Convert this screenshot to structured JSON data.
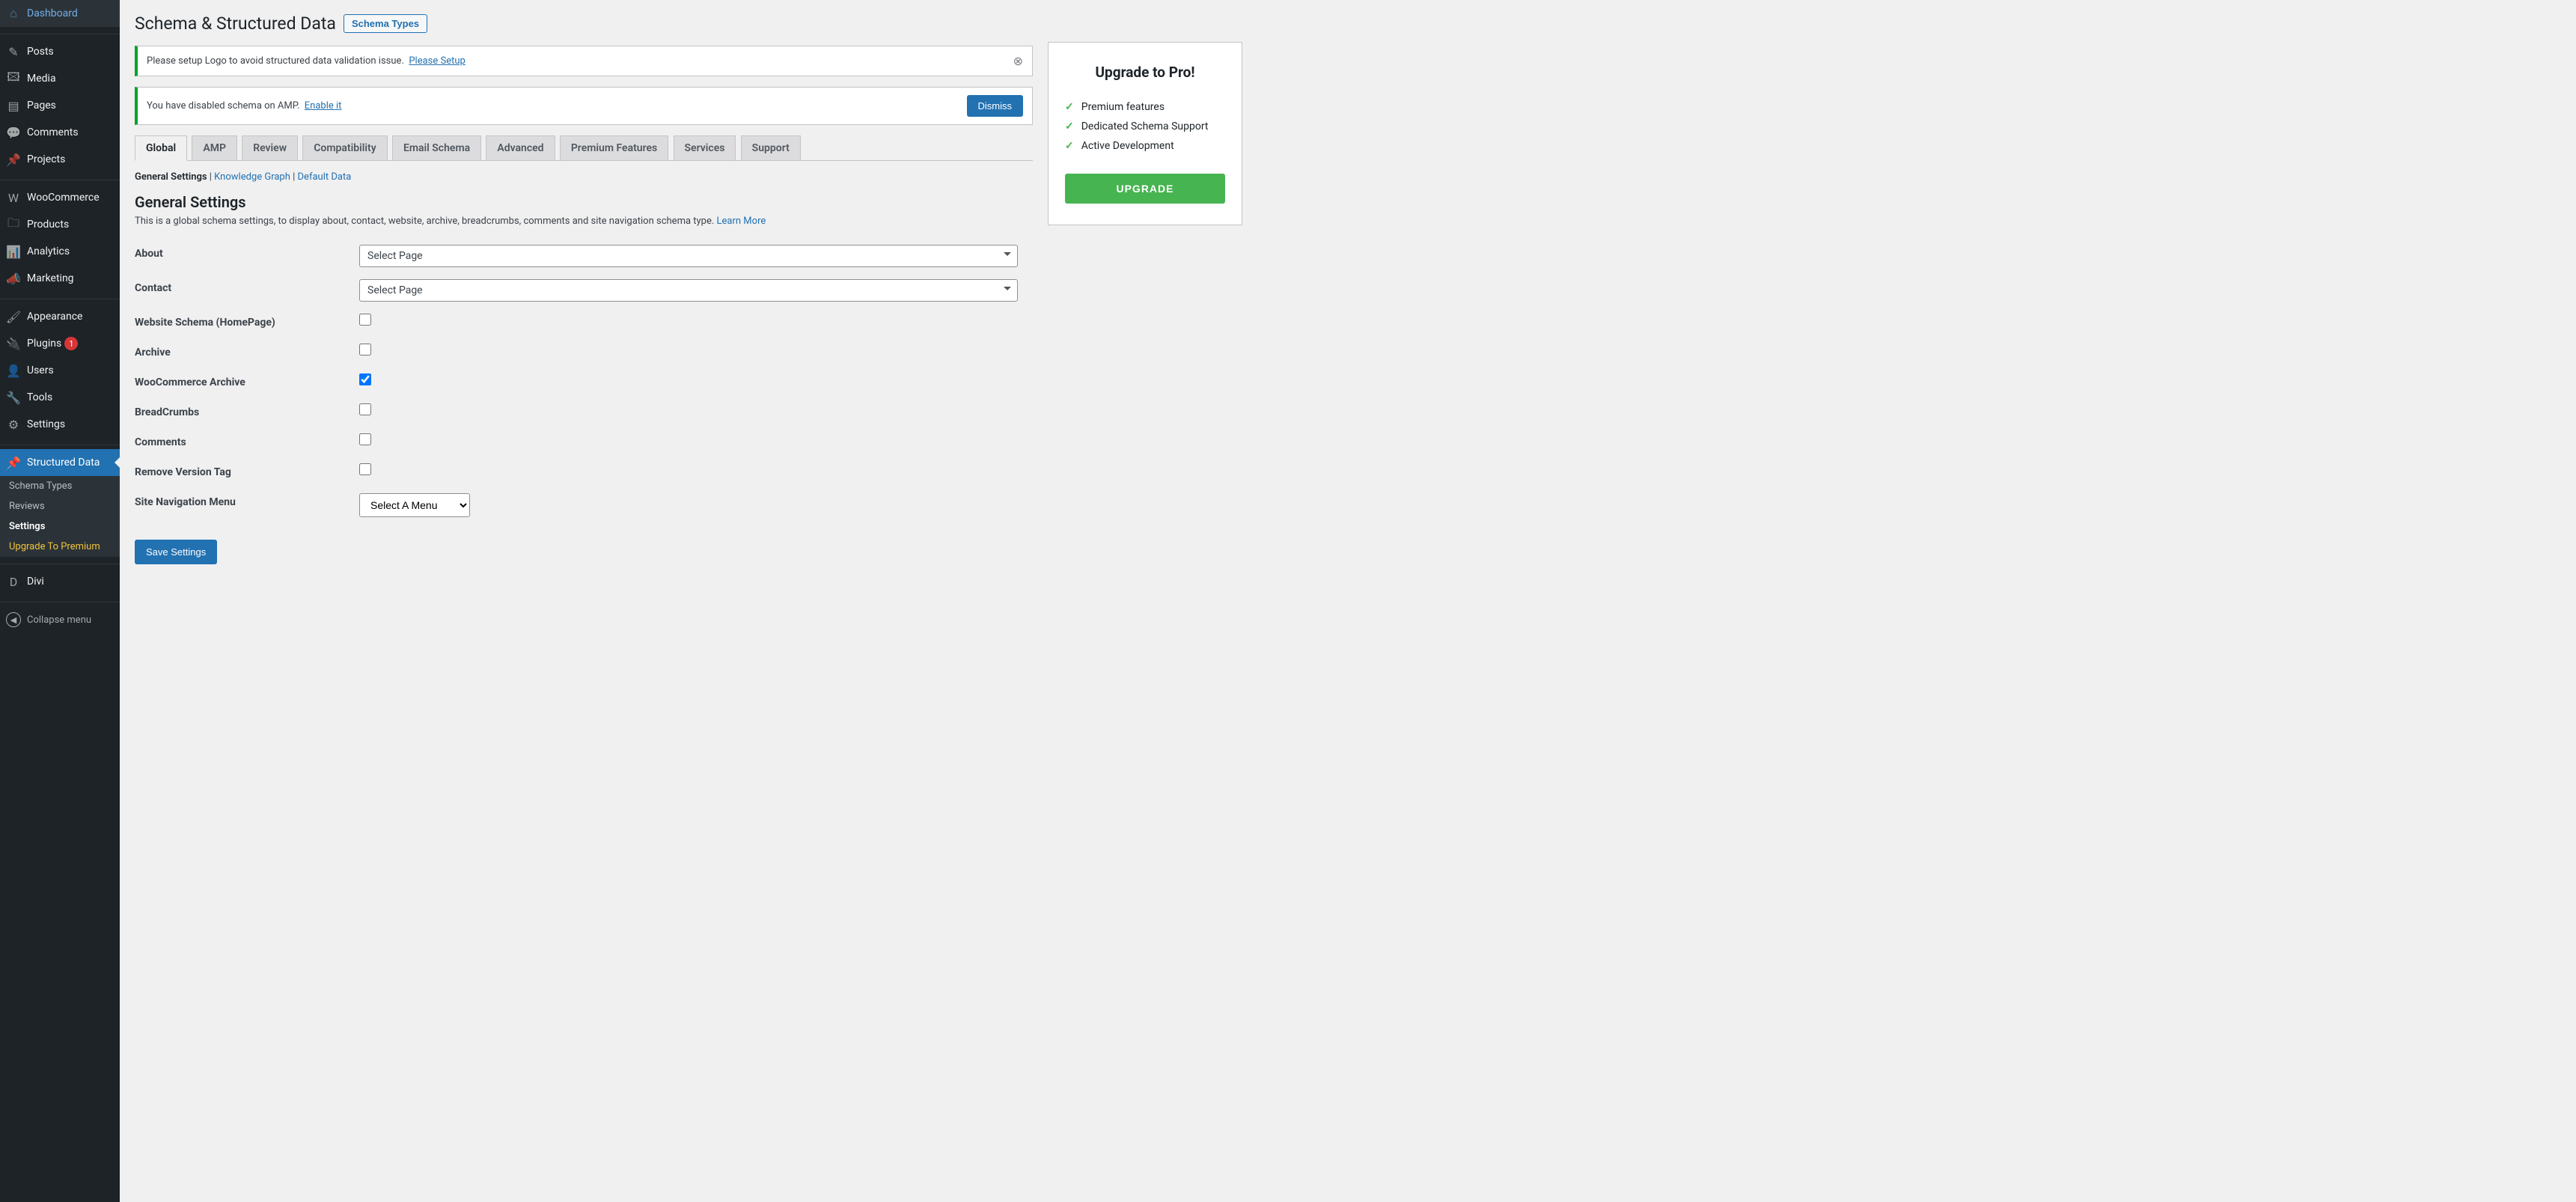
{
  "sidebar": {
    "items": [
      {
        "icon": "⌂",
        "label": "Dashboard"
      },
      {
        "icon": "✎",
        "label": "Posts"
      },
      {
        "icon": "🖾",
        "label": "Media"
      },
      {
        "icon": "▤",
        "label": "Pages"
      },
      {
        "icon": "💬",
        "label": "Comments"
      },
      {
        "icon": "📌",
        "label": "Projects"
      },
      {
        "icon": "W",
        "label": "WooCommerce"
      },
      {
        "icon": "🗀",
        "label": "Products"
      },
      {
        "icon": "📊",
        "label": "Analytics"
      },
      {
        "icon": "📣",
        "label": "Marketing"
      },
      {
        "icon": "🖌",
        "label": "Appearance"
      },
      {
        "icon": "🔌",
        "label": "Plugins",
        "badge": "1"
      },
      {
        "icon": "👤",
        "label": "Users"
      },
      {
        "icon": "🔧",
        "label": "Tools"
      },
      {
        "icon": "⚙",
        "label": "Settings"
      },
      {
        "icon": "📌",
        "label": "Structured Data",
        "active": true
      },
      {
        "icon": "D",
        "label": "Divi"
      }
    ],
    "submenu": [
      {
        "label": "Schema Types"
      },
      {
        "label": "Reviews"
      },
      {
        "label": "Settings",
        "current": true
      },
      {
        "label": "Upgrade To Premium",
        "highlight": true
      }
    ],
    "collapse": "Collapse menu"
  },
  "header": {
    "title": "Schema & Structured Data",
    "action": "Schema Types"
  },
  "notices": [
    {
      "text": "Please setup Logo to avoid structured data validation issue.",
      "link": "Please Setup",
      "dismiss": true
    },
    {
      "text": "You have disabled schema on AMP.",
      "link": "Enable it",
      "button": "Dismiss"
    }
  ],
  "tabs": [
    "Global",
    "AMP",
    "Review",
    "Compatibility",
    "Email Schema",
    "Advanced",
    "Premium Features",
    "Services",
    "Support"
  ],
  "active_tab": "Global",
  "subsub": {
    "current": "General Settings",
    "links": [
      "Knowledge Graph",
      "Default Data"
    ]
  },
  "section": {
    "title": "General Settings",
    "desc": "This is a global schema settings, to display about, contact, website, archive, breadcrumbs, comments and site navigation schema type.",
    "learn": "Learn More"
  },
  "fields": {
    "about": {
      "label": "About",
      "value": "Select Page"
    },
    "contact": {
      "label": "Contact",
      "value": "Select Page"
    },
    "website": {
      "label": "Website Schema (HomePage)",
      "checked": false
    },
    "archive": {
      "label": "Archive",
      "checked": false
    },
    "woo": {
      "label": "WooCommerce Archive",
      "checked": true
    },
    "breadcrumbs": {
      "label": "BreadCrumbs",
      "checked": false
    },
    "comments": {
      "label": "Comments",
      "checked": false
    },
    "version": {
      "label": "Remove Version Tag",
      "checked": false
    },
    "nav": {
      "label": "Site Navigation Menu",
      "value": "Select A Menu"
    }
  },
  "save": "Save Settings",
  "pro": {
    "title": "Upgrade to Pro!",
    "features": [
      "Premium features",
      "Dedicated Schema Support",
      "Active Development"
    ],
    "button": "UPGRADE"
  }
}
